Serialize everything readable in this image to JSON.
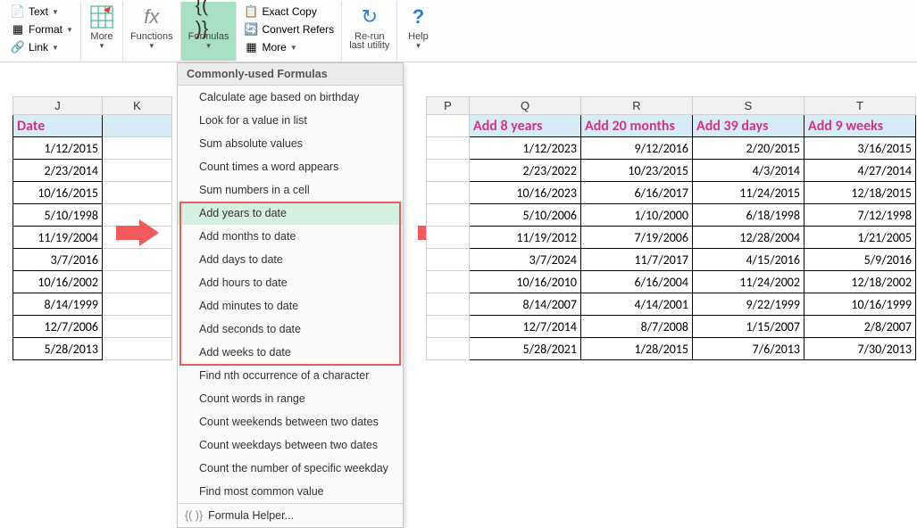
{
  "ribbon": {
    "text_label": "Text",
    "format_label": "Format",
    "link_label": "Link",
    "more_label": "More",
    "functions_label": "Functions",
    "formulas_label": "Formulas",
    "exact_copy_label": "Exact Copy",
    "convert_refers_label": "Convert Refers",
    "more2_label": "More",
    "rerun_label": "Re-run",
    "rerun_label2": "last utility",
    "help_label": "Help"
  },
  "dropdown": {
    "section": "Commonly-used Formulas",
    "items": [
      "Calculate age based on birthday",
      "Look for a value in list",
      "Sum absolute values",
      "Count times a word appears",
      "Sum numbers in a cell",
      "Add years to date",
      "Add months to date",
      "Add days to date",
      "Add hours to date",
      "Add minutes to date",
      "Add seconds to date",
      "Add weeks to date",
      "Find nth occurrence of a character",
      "Count words in range",
      "Count weekends between two dates",
      "Count weekdays between two dates",
      "Count the number of specific weekday",
      "Find most common value"
    ],
    "helper": "Formula Helper..."
  },
  "left_cols": {
    "j": "J",
    "k": "K"
  },
  "left_header": "Date",
  "left_rows": [
    "1/12/2015",
    "2/23/2014",
    "10/16/2015",
    "5/10/1998",
    "11/19/2004",
    "3/7/2016",
    "10/16/2002",
    "8/14/1999",
    "12/7/2006",
    "5/28/2013"
  ],
  "right_cols": {
    "p": "P",
    "q": "Q",
    "r": "R",
    "s": "S",
    "t": "T"
  },
  "right_headers": {
    "q": "Add 8 years",
    "r": "Add 20 months",
    "s": "Add 39 days",
    "t": "Add 9 weeks"
  },
  "right_rows": [
    {
      "q": "1/12/2023",
      "r": "9/12/2016",
      "s": "2/20/2015",
      "t": "3/16/2015"
    },
    {
      "q": "2/23/2022",
      "r": "10/23/2015",
      "s": "4/3/2014",
      "t": "4/27/2014"
    },
    {
      "q": "10/16/2023",
      "r": "6/16/2017",
      "s": "11/24/2015",
      "t": "12/18/2015"
    },
    {
      "q": "5/10/2006",
      "r": "1/10/2000",
      "s": "6/18/1998",
      "t": "7/12/1998"
    },
    {
      "q": "11/19/2012",
      "r": "7/19/2006",
      "s": "12/28/2004",
      "t": "1/21/2005"
    },
    {
      "q": "3/7/2024",
      "r": "11/7/2017",
      "s": "4/15/2016",
      "t": "5/9/2016"
    },
    {
      "q": "10/16/2010",
      "r": "6/16/2004",
      "s": "11/24/2002",
      "t": "12/18/2002"
    },
    {
      "q": "8/14/2007",
      "r": "4/14/2001",
      "s": "9/22/1999",
      "t": "10/16/1999"
    },
    {
      "q": "12/7/2014",
      "r": "8/7/2008",
      "s": "1/15/2007",
      "t": "2/8/2007"
    },
    {
      "q": "5/28/2021",
      "r": "1/28/2015",
      "s": "7/6/2013",
      "t": "7/30/2013"
    }
  ]
}
